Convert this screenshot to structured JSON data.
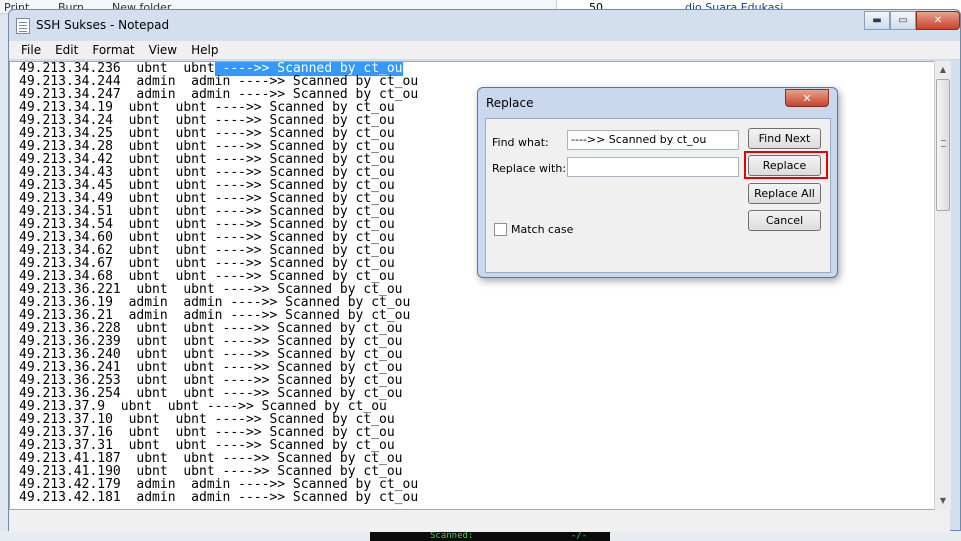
{
  "background": {
    "items": [
      "Print",
      "Burn",
      "New folder"
    ],
    "right_cell": "50",
    "right_text": "dio Suara Edukasi ...",
    "terminal_text": "Scanned:",
    "terminal_suffix": "-/-"
  },
  "window": {
    "title": "SSH Sukses - Notepad",
    "minimize": "▬",
    "maximize": "▭",
    "close": "✕"
  },
  "menu": [
    "File",
    "Edit",
    "Format",
    "View",
    "Help"
  ],
  "lines": [
    {
      "pre": "49.213.34.236  ubnt  ubnt",
      "sel": " ---->> Scanned by ct_ou"
    },
    {
      "pre": "49.213.34.244  admin  admin ---->> Scanned by ct_ou"
    },
    {
      "pre": "49.213.34.247  admin  admin ---->> Scanned by ct_ou"
    },
    {
      "pre": "49.213.34.19  ubnt  ubnt ---->> Scanned by ct_ou"
    },
    {
      "pre": "49.213.34.24  ubnt  ubnt ---->> Scanned by ct_ou"
    },
    {
      "pre": "49.213.34.25  ubnt  ubnt ---->> Scanned by ct_ou"
    },
    {
      "pre": "49.213.34.28  ubnt  ubnt ---->> Scanned by ct_ou"
    },
    {
      "pre": "49.213.34.42  ubnt  ubnt ---->> Scanned by ct_ou"
    },
    {
      "pre": "49.213.34.43  ubnt  ubnt ---->> Scanned by ct_ou"
    },
    {
      "pre": "49.213.34.45  ubnt  ubnt ---->> Scanned by ct_ou"
    },
    {
      "pre": "49.213.34.49  ubnt  ubnt ---->> Scanned by ct_ou"
    },
    {
      "pre": "49.213.34.51  ubnt  ubnt ---->> Scanned by ct_ou"
    },
    {
      "pre": "49.213.34.54  ubnt  ubnt ---->> Scanned by ct_ou"
    },
    {
      "pre": "49.213.34.60  ubnt  ubnt ---->> Scanned by ct_ou"
    },
    {
      "pre": "49.213.34.62  ubnt  ubnt ---->> Scanned by ct_ou"
    },
    {
      "pre": "49.213.34.67  ubnt  ubnt ---->> Scanned by ct_ou"
    },
    {
      "pre": "49.213.34.68  ubnt  ubnt ---->> Scanned by ct_ou"
    },
    {
      "pre": "49.213.36.221  ubnt  ubnt ---->> Scanned by ct_ou"
    },
    {
      "pre": "49.213.36.19  admin  admin ---->> Scanned by ct_ou"
    },
    {
      "pre": "49.213.36.21  admin  admin ---->> Scanned by ct_ou"
    },
    {
      "pre": "49.213.36.228  ubnt  ubnt ---->> Scanned by ct_ou"
    },
    {
      "pre": "49.213.36.239  ubnt  ubnt ---->> Scanned by ct_ou"
    },
    {
      "pre": "49.213.36.240  ubnt  ubnt ---->> Scanned by ct_ou"
    },
    {
      "pre": "49.213.36.241  ubnt  ubnt ---->> Scanned by ct_ou"
    },
    {
      "pre": "49.213.36.253  ubnt  ubnt ---->> Scanned by ct_ou"
    },
    {
      "pre": "49.213.36.254  ubnt  ubnt ---->> Scanned by ct_ou"
    },
    {
      "pre": "49.213.37.9  ubnt  ubnt ---->> Scanned by ct_ou"
    },
    {
      "pre": "49.213.37.10  ubnt  ubnt ---->> Scanned by ct_ou"
    },
    {
      "pre": "49.213.37.16  ubnt  ubnt ---->> Scanned by ct_ou"
    },
    {
      "pre": "49.213.37.31  ubnt  ubnt ---->> Scanned by ct_ou"
    },
    {
      "pre": "49.213.41.187  ubnt  ubnt ---->> Scanned by ct_ou"
    },
    {
      "pre": "49.213.41.190  ubnt  ubnt ---->> Scanned by ct_ou"
    },
    {
      "pre": "49.213.42.179  admin  admin ---->> Scanned by ct_ou"
    },
    {
      "pre": "49.213.42.181  admin  admin ---->> Scanned by ct_ou"
    }
  ],
  "dialog": {
    "title": "Replace",
    "close": "✕",
    "find_label": "Find what:",
    "find_value": "---->> Scanned by ct_ou",
    "replace_label": "Replace with:",
    "replace_value": "",
    "match_case_label": "Match case",
    "match_case_checked": false,
    "buttons": {
      "find_next": "Find Next",
      "replace": "Replace",
      "replace_all": "Replace All",
      "cancel": "Cancel"
    },
    "highlight_color": "#e30000"
  },
  "colors": {
    "selection": "#3399ff",
    "title_bar": "#d3dfee"
  }
}
